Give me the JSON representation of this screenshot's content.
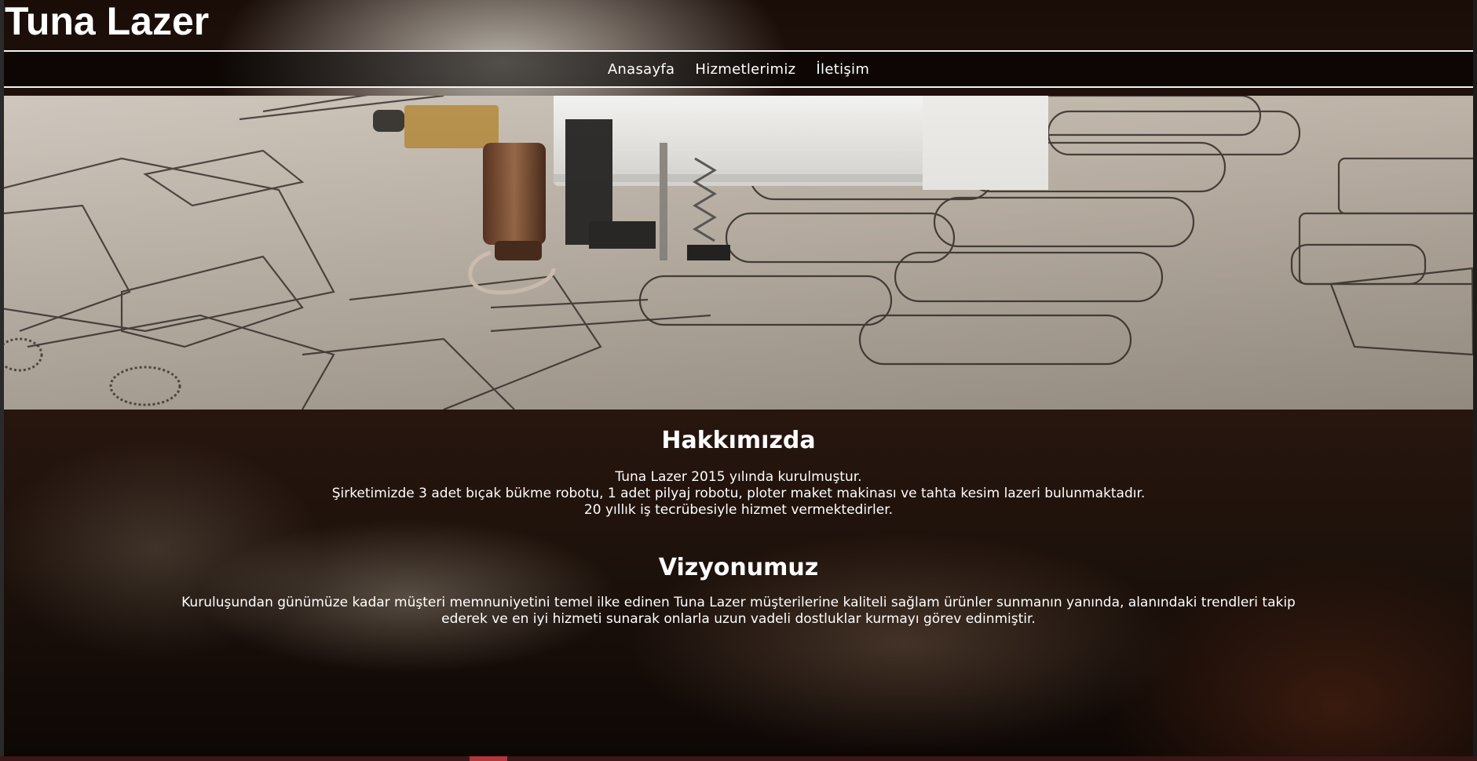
{
  "site": {
    "title": "Tuna Lazer"
  },
  "nav": {
    "items": [
      {
        "label": "Anasayfa"
      },
      {
        "label": "Hizmetlerimiz"
      },
      {
        "label": "İletişim"
      }
    ]
  },
  "hero": {
    "image": "laser-cutting-machine-photo"
  },
  "about": {
    "title": "Hakkımızda",
    "lines": [
      "Tuna Lazer 2015 yılında kurulmuştur.",
      "Şirketimizde 3 adet bıçak bükme robotu, 1 adet pilyaj robotu, ploter maket makinası ve tahta kesim lazeri bulunmaktadır.",
      "20 yıllık iş tecrübesiyle hizmet vermektedirler."
    ]
  },
  "vision": {
    "title": "Vizyonumuz",
    "body": "Kuruluşundan günümüze kadar müşteri memnuniyetini temel ilke edinen Tuna Lazer müşterilerine kaliteli sağlam ürünler sunmanın yanında, alanındaki trendleri takip ederek ve en iyi hizmeti sunarak onlarla uzun vadeli dostluklar kurmayı görev edinmiştir."
  },
  "colors": {
    "text": "#ffffff",
    "nav_border": "#f2f2f2",
    "bottom_accent": "#b4363a"
  }
}
